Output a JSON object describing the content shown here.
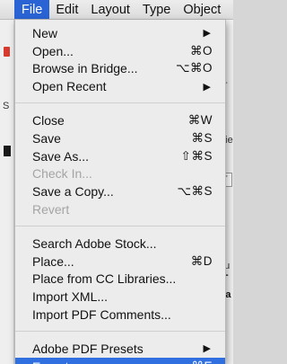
{
  "menubar": {
    "items": [
      "File",
      "Edit",
      "Layout",
      "Type",
      "Object"
    ]
  },
  "background": {
    "right_fragments": [
      "e",
      "p-",
      "Vie",
      "T",
      "bu",
      "-T",
      "Sa"
    ],
    "left_fragments": [
      "S",
      "S"
    ]
  },
  "file_menu": {
    "groups": [
      [
        {
          "label": "New",
          "shortcut": "",
          "submenu": true,
          "disabled": false
        },
        {
          "label": "Open...",
          "shortcut": "⌘O",
          "submenu": false,
          "disabled": false
        },
        {
          "label": "Browse in Bridge...",
          "shortcut": "⌥⌘O",
          "submenu": false,
          "disabled": false
        },
        {
          "label": "Open Recent",
          "shortcut": "",
          "submenu": true,
          "disabled": false
        }
      ],
      [
        {
          "label": "Close",
          "shortcut": "⌘W",
          "submenu": false,
          "disabled": false
        },
        {
          "label": "Save",
          "shortcut": "⌘S",
          "submenu": false,
          "disabled": false
        },
        {
          "label": "Save As...",
          "shortcut": "⇧⌘S",
          "submenu": false,
          "disabled": false
        },
        {
          "label": "Check In...",
          "shortcut": "",
          "submenu": false,
          "disabled": true
        },
        {
          "label": "Save a Copy...",
          "shortcut": "⌥⌘S",
          "submenu": false,
          "disabled": false
        },
        {
          "label": "Revert",
          "shortcut": "",
          "submenu": false,
          "disabled": true
        }
      ],
      [
        {
          "label": "Search Adobe Stock...",
          "shortcut": "",
          "submenu": false,
          "disabled": false
        },
        {
          "label": "Place...",
          "shortcut": "⌘D",
          "submenu": false,
          "disabled": false
        },
        {
          "label": "Place from CC Libraries...",
          "shortcut": "",
          "submenu": false,
          "disabled": false
        },
        {
          "label": "Import XML...",
          "shortcut": "",
          "submenu": false,
          "disabled": false
        },
        {
          "label": "Import PDF Comments...",
          "shortcut": "",
          "submenu": false,
          "disabled": false
        }
      ],
      [
        {
          "label": "Adobe PDF Presets",
          "shortcut": "",
          "submenu": true,
          "disabled": false
        },
        {
          "label": "Export...",
          "shortcut": "⌘E",
          "submenu": false,
          "disabled": false,
          "highlighted": true
        }
      ]
    ]
  },
  "colors": {
    "highlight": "#2f6fe0",
    "menubar_active": "#2a63d4",
    "disabled_text": "#a4a4a4"
  }
}
